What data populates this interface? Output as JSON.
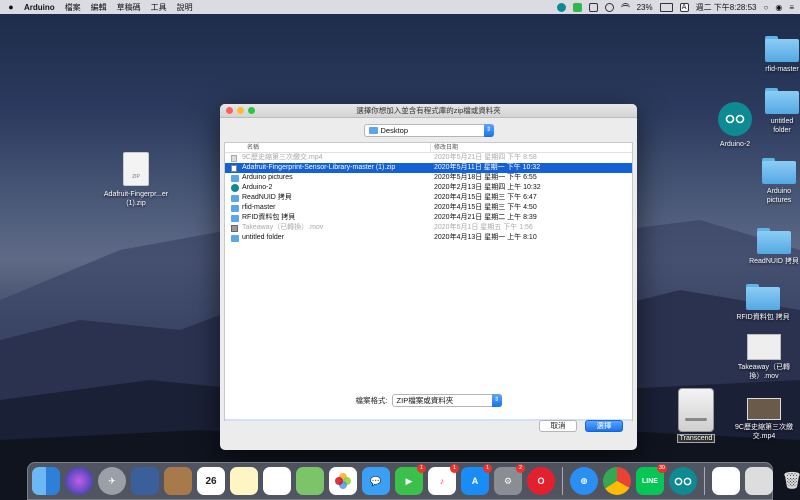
{
  "menubar": {
    "app_name": "Arduino",
    "menus": [
      "檔案",
      "編輯",
      "草稿碼",
      "工具",
      "說明"
    ],
    "battery": "23%",
    "input_method": "A",
    "clock": "週二 下午8:28:53"
  },
  "desktop": {
    "left_file": "Adafruit-Fingerpr...er (1).zip",
    "right_items": [
      "rfid-master",
      "untitled folder",
      "Arduino-2",
      "Arduino pictures",
      "ReadNUID 拷貝",
      "RFID資料包 拷貝",
      "Takeaway（已轉換）.mov",
      "9C歷史縮第三次繳交.mp4",
      "Transcend"
    ],
    "zip_label": "ZIP"
  },
  "dialog": {
    "title": "選擇你想加入並含有程式庫的zip檔或資料夾",
    "location": "Desktop",
    "columns": {
      "name": "名稱",
      "date": "修改日期"
    },
    "files": [
      {
        "name": "9C歷史縮第三次繳交.mp4",
        "date": "2020年5月21日 星期四 下午 8:58",
        "icon": "file",
        "state": "dim"
      },
      {
        "name": "Adafruit-Fingerprint-Sensor-Library-master (1).zip",
        "date": "2020年5月11日 星期一 下午 10:32",
        "icon": "zip",
        "state": "selected"
      },
      {
        "name": "Arduino pictures",
        "date": "2020年5月18日 星期一 下午 6:55",
        "icon": "folder",
        "state": "normal"
      },
      {
        "name": "Arduino-2",
        "date": "2020年2月13日 星期四 上午 10:32",
        "icon": "ard",
        "state": "normal"
      },
      {
        "name": "ReadNUID 拷貝",
        "date": "2020年4月15日 星期三 下午 6:47",
        "icon": "folder",
        "state": "normal"
      },
      {
        "name": "rfid-master",
        "date": "2020年4月15日 星期三 下午 4:50",
        "icon": "folder",
        "state": "normal"
      },
      {
        "name": "RFID資料包 拷貝",
        "date": "2020年4月21日 星期二 上午 8:39",
        "icon": "folder",
        "state": "normal"
      },
      {
        "name": "Takeaway（已轉換）.mov",
        "date": "2020年5月1日 星期五 下午 1:56",
        "icon": "video",
        "state": "dim"
      },
      {
        "name": "untitled folder",
        "date": "2020年4月13日 星期一 上午 8:10",
        "icon": "folder",
        "state": "normal"
      }
    ],
    "format_label": "檔案格式:",
    "format_value": "ZIP檔案或資料夾",
    "cancel_label": "取消",
    "ok_label": "選擇"
  },
  "dock": {
    "calendar_day": "26",
    "facetime_badge": "1",
    "music_badge": "1",
    "appstore_badge": "1",
    "prefs_badge": "2",
    "line_badge": "30",
    "line_label": "LINE"
  },
  "colors": {
    "accent": "#1460d6",
    "selection": "#1460d6",
    "folder": "#5aa6e8",
    "arduino": "#0e8a93"
  }
}
